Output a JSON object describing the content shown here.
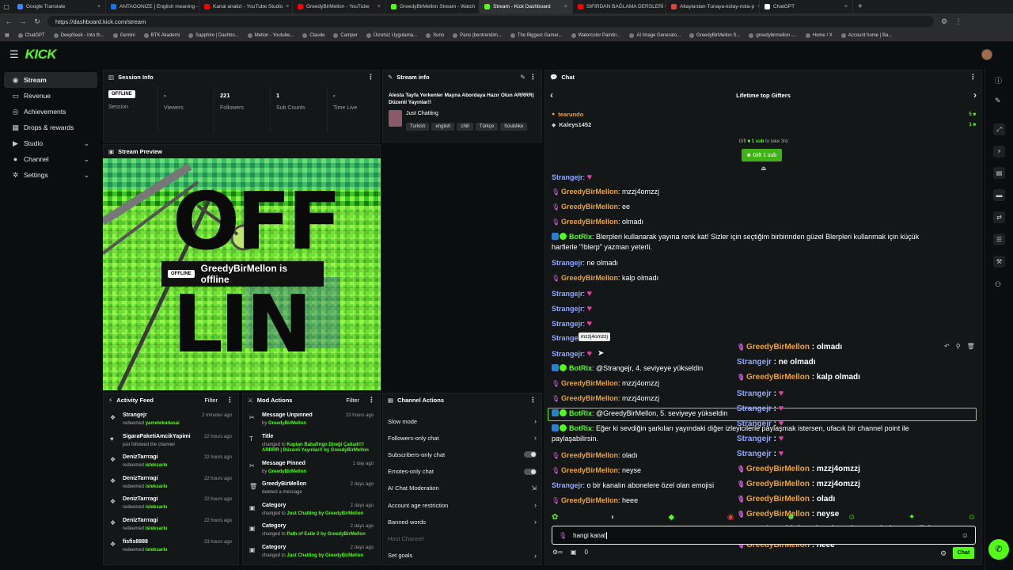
{
  "browser": {
    "tabs": [
      {
        "label": "Google Translate",
        "color": "#4285f4"
      },
      {
        "label": "ANTAGONIZE | English meaning -",
        "color": "#1a73e8"
      },
      {
        "label": "Kanal analizi - YouTube Studio",
        "color": "#ff0000"
      },
      {
        "label": "GreedyBirMellon - YouTube",
        "color": "#ff0000"
      },
      {
        "label": "GreedyBirMellon Stream - Watch",
        "color": "#53fc18"
      },
      {
        "label": "Stream - Kick Dashboard",
        "color": "#53fc18"
      },
      {
        "label": "SIFIRDAN BAĞLAMA DERSLERİ 6 (",
        "color": "#ff0000"
      },
      {
        "label": "Altaylardan-Tunaya-kolay-nota-p",
        "color": "#e04040"
      },
      {
        "label": "ChatGPT",
        "color": "#ffffff"
      }
    ],
    "url": "https://dashboard.kick.com/stream",
    "bookmarks": [
      "ChatGPT",
      "DeepSeek - Into th...",
      "Gemini",
      "BTK Akademi",
      "Sapphire | Dashbo...",
      "Mellon - Youtube...",
      "Claude",
      "Camper",
      "Ücretsiz Uygulama...",
      "Suno",
      "Pano (bentrendim...",
      "The Biggest Gamer...",
      "Watercolor Paintin...",
      "AI Image Generato...",
      "GreedyBirMellon S...",
      "greedybirmellon -...",
      "Home / X",
      "Account home | Ba..."
    ]
  },
  "brand": {
    "logo": "KICK",
    "accent": "#53fc18"
  },
  "sidebar": {
    "items": [
      {
        "label": "Stream",
        "icon": "broadcast-icon",
        "glyph": "◉",
        "chevron": false
      },
      {
        "label": "Revenue",
        "icon": "dollar-icon",
        "glyph": "▭",
        "chevron": false
      },
      {
        "label": "Achievements",
        "icon": "trophy-icon",
        "glyph": "◎",
        "chevron": false
      },
      {
        "label": "Drops & rewards",
        "icon": "gift-icon",
        "glyph": "▦",
        "chevron": false
      },
      {
        "label": "Studio",
        "icon": "video-icon",
        "glyph": "▶",
        "chevron": true
      },
      {
        "label": "Channel",
        "icon": "user-icon",
        "glyph": "●",
        "chevron": true
      },
      {
        "label": "Settings",
        "icon": "gear-icon",
        "glyph": "✲",
        "chevron": true
      }
    ]
  },
  "session": {
    "title": "Session Info",
    "status": "OFFLINE",
    "session_label": "Session",
    "stats": [
      {
        "value": "-",
        "label": "Viewers"
      },
      {
        "value": "221",
        "label": "Followers"
      },
      {
        "value": "1",
        "label": "Sub Counts"
      },
      {
        "value": "-",
        "label": "Time Live"
      }
    ]
  },
  "stream_info": {
    "title": "Stream info",
    "stream_title": "Alesta Tayfa Yerkenler Mayna Abordaya Hazır Olun ARRRR| Düzenli Yayınlar!!",
    "category": "Just Chatting",
    "tags": [
      "Turkish",
      "english",
      "chill",
      "Türkçe",
      "Soulslike"
    ]
  },
  "preview": {
    "title": "Stream Preview",
    "badge": "OFFLINE",
    "message": "GreedyBirMellon is offline",
    "art_text_top": "OFF",
    "art_text_bottom": "LIN"
  },
  "activity": {
    "title": "Activity Feed",
    "filter": "Filter",
    "items": [
      {
        "name": "Strangejr",
        "action": "redeemed",
        "target": "yametekudasai",
        "time": "2 minutes ago",
        "icon": "redeem-icon",
        "glyph": "❖"
      },
      {
        "name": "SigaraPaketiAmcikYapimi",
        "action": "just followed the channel",
        "target": "",
        "time": "22 hours ago",
        "icon": "heart-icon",
        "glyph": "♥"
      },
      {
        "name": "DenizTarrragi",
        "action": "redeemed",
        "target": "isteksarkı",
        "time": "22 hours ago",
        "icon": "redeem-icon",
        "glyph": "❖"
      },
      {
        "name": "DenizTarrragi",
        "action": "redeemed",
        "target": "isteksarkı",
        "time": "22 hours ago",
        "icon": "redeem-icon",
        "glyph": "❖"
      },
      {
        "name": "DenizTarrragi",
        "action": "redeemed",
        "target": "isteksarkı",
        "time": "22 hours ago",
        "icon": "redeem-icon",
        "glyph": "❖"
      },
      {
        "name": "DenizTarrragi",
        "action": "redeemed",
        "target": "isteksarkı",
        "time": "22 hours ago",
        "icon": "redeem-icon",
        "glyph": "❖"
      },
      {
        "name": "fisfis8888",
        "action": "redeemed",
        "target": "isteksarkı",
        "time": "23 hours ago",
        "icon": "redeem-icon",
        "glyph": "❖"
      }
    ]
  },
  "mod_actions": {
    "title": "Mod Actions",
    "filter": "Filter",
    "items": [
      {
        "name": "Message Unpinned",
        "line": "by",
        "who": "GreedyBirMellon",
        "extra": "",
        "time": "23 hours ago",
        "glyph": "✂"
      },
      {
        "name": "Title",
        "line": "changed to",
        "who": "Kaptan Babafingo Direği Çatladı!!! ARRRR | Düzenli Yayınlar!! by GreedyBirMellon",
        "extra": "",
        "time": "",
        "glyph": "T"
      },
      {
        "name": "Message Pinned",
        "line": "by",
        "who": "GreedyBirMellon",
        "extra": "",
        "time": "1 day ago",
        "glyph": "✂"
      },
      {
        "name": "GreedyBirMellon",
        "line": "deleted a message",
        "who": "",
        "extra": "",
        "time": "2 days ago",
        "glyph": "🗑"
      },
      {
        "name": "Category",
        "line": "changed to",
        "who": "Just Chatting",
        "extra": "by GreedyBirMellon",
        "time": "2 days ago",
        "glyph": "▣"
      },
      {
        "name": "Category",
        "line": "changed to",
        "who": "Path of Exile 2",
        "extra": "by GreedyBirMellon",
        "time": "2 days ago",
        "glyph": "▣"
      },
      {
        "name": "Category",
        "line": "changed to",
        "who": "Just Chatting",
        "extra": "by GreedyBirMellon",
        "time": "2 days ago",
        "glyph": "▣"
      }
    ]
  },
  "channel_actions": {
    "title": "Channel Actions",
    "items": [
      {
        "label": "Slow mode",
        "kind": "chevron"
      },
      {
        "label": "Followers-only chat",
        "kind": "chevron"
      },
      {
        "label": "Subscribers-only chat",
        "kind": "toggle"
      },
      {
        "label": "Emotes-only chat",
        "kind": "toggle"
      },
      {
        "label": "AI Chat Moderation",
        "kind": "external"
      },
      {
        "label": "Account age restriction",
        "kind": "chevron"
      },
      {
        "label": "Banned words",
        "kind": "chevron"
      },
      {
        "label": "Host Channel",
        "kind": "none"
      },
      {
        "label": "Set goals",
        "kind": "chevron"
      }
    ]
  },
  "chat": {
    "title": "Chat",
    "gifters_title": "Lifetime top Gifters",
    "gifters": [
      {
        "name": "tearundo",
        "count": "5"
      },
      {
        "name": "Kaleys1452",
        "count": "1"
      }
    ],
    "gift_prompt_prefix": "Gift",
    "gift_prompt_mid": "1 sub",
    "gift_prompt_suffix": "to take 3rd",
    "gift_button": "Gift 1 sub",
    "tooltip": "mzzj4omzzj",
    "messages": [
      {
        "user": "Strangejr",
        "kind": "blue",
        "text": "",
        "emote": true
      },
      {
        "user": "GreedyBirMellon",
        "kind": "orange",
        "text": "mzzj4omzzj"
      },
      {
        "user": "GreedyBirMellon",
        "kind": "orange",
        "text": "ee"
      },
      {
        "user": "GreedyBirMellon",
        "kind": "orange",
        "text": "olmadı"
      },
      {
        "user": "BotRix",
        "kind": "bot",
        "text": "Blerpleri kullanarak yayına renk kat! Sizler için seçtiğim birbirinden güzel Blerpleri kullanmak için küçük",
        "text2": "harflerle \"!blerp\" yazman yeterli."
      },
      {
        "user": "Strangejr",
        "kind": "blue",
        "text": "ne olmadı"
      },
      {
        "user": "GreedyBirMellon",
        "kind": "orange",
        "text": "kalp olmadı"
      },
      {
        "user": "Strangejr",
        "kind": "blue",
        "text": "",
        "emote": true
      },
      {
        "user": "Strangejr",
        "kind": "blue",
        "text": "",
        "emote": true
      },
      {
        "user": "Strangejr",
        "kind": "blue",
        "text": "",
        "emote": true
      },
      {
        "user": "Strange",
        "kind": "blue",
        "text": "",
        "emote": false
      },
      {
        "user": "Strangejr",
        "kind": "blue",
        "text": "",
        "emote": true
      },
      {
        "user": "BotRix",
        "kind": "bot",
        "text": "@Strangejr, 4. seviyeye yükseldin"
      },
      {
        "user": "GreedyBirMellon",
        "kind": "orange",
        "text": "mzzj4omzzj"
      },
      {
        "user": "GreedyBirMellon",
        "kind": "orange",
        "text": "mzzj4omzzj"
      },
      {
        "user": "BotRix",
        "kind": "bot",
        "text": "@GreedyBirMellon, 5. seviyeye yükseldin"
      },
      {
        "user": "BotRix",
        "kind": "bot",
        "text": "Eğer ki sevdiğin şarkıları yayındaki diğer izleyicilerle paylaşmak istersen, ufacık bir channel point ile",
        "text2": "paylaşabilirsin."
      },
      {
        "user": "GreedyBirMellon",
        "kind": "orange",
        "text": "oladı"
      },
      {
        "user": "GreedyBirMellon",
        "kind": "orange",
        "text": "neyse"
      },
      {
        "user": "Strangejr",
        "kind": "blue",
        "text": "o bir kanalın abonelere özel olan emojisi"
      },
      {
        "user": "GreedyBirMellon",
        "kind": "orange",
        "text": "heee"
      }
    ],
    "overlay": [
      {
        "user": "GreedyBirMellon",
        "kind": "orange",
        "text": "olmadı"
      },
      {
        "user": "Strangejr",
        "kind": "blue",
        "text": "ne olmadı"
      },
      {
        "user": "GreedyBirMellon",
        "kind": "orange",
        "text": "kalp olmadı"
      },
      {
        "user": "Strangejr",
        "kind": "blue",
        "text": "",
        "emote": true
      },
      {
        "user": "Strangejr",
        "kind": "blue",
        "text": "",
        "emote": true
      },
      {
        "user": "Strangejr",
        "kind": "blue",
        "text": "",
        "emote": true
      },
      {
        "user": "Strangejr",
        "kind": "blue",
        "text": "",
        "emote": true
      },
      {
        "user": "Strangejr",
        "kind": "blue",
        "text": "",
        "emote": true
      },
      {
        "user": "GreedyBirMellon",
        "kind": "orange",
        "text": "mzzj4omzzj"
      },
      {
        "user": "GreedyBirMellon",
        "kind": "orange",
        "text": "mzzj4omzzj"
      },
      {
        "user": "GreedyBirMellon",
        "kind": "orange",
        "text": "oladı"
      },
      {
        "user": "GreedyBirMellon",
        "kind": "orange",
        "text": "neyse"
      },
      {
        "user": "Strangejr",
        "kind": "blue",
        "text": "o bir kanalın abonelere özel olan emojisi"
      },
      {
        "user": "GreedyBirMellon",
        "kind": "orange",
        "text": "heee"
      }
    ],
    "input_value": "hangi kanal",
    "points": "0",
    "send_label": "Chat"
  }
}
